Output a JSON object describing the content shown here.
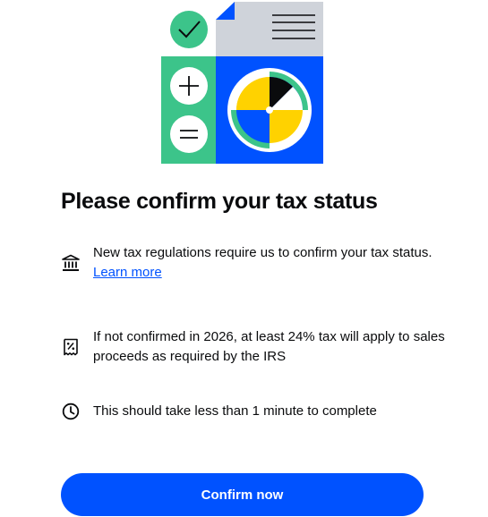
{
  "illustration": {
    "colors": {
      "green": "#3cc48a",
      "blue": "#0052ff",
      "gray": "#cfd3da",
      "yellow": "#ffd200",
      "black": "#0a0b0d",
      "white": "#ffffff"
    }
  },
  "title": "Please confirm your tax status",
  "rows": [
    {
      "icon": "bank-icon",
      "text": "New tax regulations require us to confirm your tax status.",
      "link": "Learn more"
    },
    {
      "icon": "tax-receipt-icon",
      "text": "If not confirmed in 2026, at least 24% tax will apply to sales proceeds as required by the IRS"
    },
    {
      "icon": "clock-icon",
      "text": "This should take less than 1 minute to complete"
    }
  ],
  "cta": {
    "label": "Confirm now",
    "color": "#0052ff"
  }
}
